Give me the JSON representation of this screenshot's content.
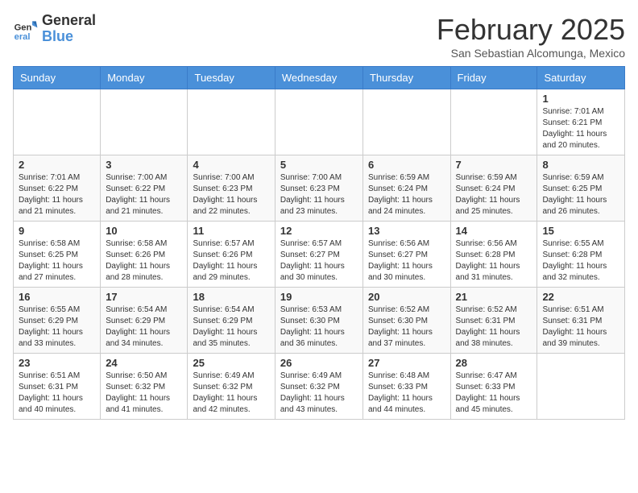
{
  "header": {
    "logo_general": "General",
    "logo_blue": "Blue",
    "month_title": "February 2025",
    "location": "San Sebastian Alcomunga, Mexico"
  },
  "weekdays": [
    "Sunday",
    "Monday",
    "Tuesday",
    "Wednesday",
    "Thursday",
    "Friday",
    "Saturday"
  ],
  "weeks": [
    [
      {
        "day": "",
        "info": ""
      },
      {
        "day": "",
        "info": ""
      },
      {
        "day": "",
        "info": ""
      },
      {
        "day": "",
        "info": ""
      },
      {
        "day": "",
        "info": ""
      },
      {
        "day": "",
        "info": ""
      },
      {
        "day": "1",
        "info": "Sunrise: 7:01 AM\nSunset: 6:21 PM\nDaylight: 11 hours and 20 minutes."
      }
    ],
    [
      {
        "day": "2",
        "info": "Sunrise: 7:01 AM\nSunset: 6:22 PM\nDaylight: 11 hours and 21 minutes."
      },
      {
        "day": "3",
        "info": "Sunrise: 7:00 AM\nSunset: 6:22 PM\nDaylight: 11 hours and 21 minutes."
      },
      {
        "day": "4",
        "info": "Sunrise: 7:00 AM\nSunset: 6:23 PM\nDaylight: 11 hours and 22 minutes."
      },
      {
        "day": "5",
        "info": "Sunrise: 7:00 AM\nSunset: 6:23 PM\nDaylight: 11 hours and 23 minutes."
      },
      {
        "day": "6",
        "info": "Sunrise: 6:59 AM\nSunset: 6:24 PM\nDaylight: 11 hours and 24 minutes."
      },
      {
        "day": "7",
        "info": "Sunrise: 6:59 AM\nSunset: 6:24 PM\nDaylight: 11 hours and 25 minutes."
      },
      {
        "day": "8",
        "info": "Sunrise: 6:59 AM\nSunset: 6:25 PM\nDaylight: 11 hours and 26 minutes."
      }
    ],
    [
      {
        "day": "9",
        "info": "Sunrise: 6:58 AM\nSunset: 6:25 PM\nDaylight: 11 hours and 27 minutes."
      },
      {
        "day": "10",
        "info": "Sunrise: 6:58 AM\nSunset: 6:26 PM\nDaylight: 11 hours and 28 minutes."
      },
      {
        "day": "11",
        "info": "Sunrise: 6:57 AM\nSunset: 6:26 PM\nDaylight: 11 hours and 29 minutes."
      },
      {
        "day": "12",
        "info": "Sunrise: 6:57 AM\nSunset: 6:27 PM\nDaylight: 11 hours and 30 minutes."
      },
      {
        "day": "13",
        "info": "Sunrise: 6:56 AM\nSunset: 6:27 PM\nDaylight: 11 hours and 30 minutes."
      },
      {
        "day": "14",
        "info": "Sunrise: 6:56 AM\nSunset: 6:28 PM\nDaylight: 11 hours and 31 minutes."
      },
      {
        "day": "15",
        "info": "Sunrise: 6:55 AM\nSunset: 6:28 PM\nDaylight: 11 hours and 32 minutes."
      }
    ],
    [
      {
        "day": "16",
        "info": "Sunrise: 6:55 AM\nSunset: 6:29 PM\nDaylight: 11 hours and 33 minutes."
      },
      {
        "day": "17",
        "info": "Sunrise: 6:54 AM\nSunset: 6:29 PM\nDaylight: 11 hours and 34 minutes."
      },
      {
        "day": "18",
        "info": "Sunrise: 6:54 AM\nSunset: 6:29 PM\nDaylight: 11 hours and 35 minutes."
      },
      {
        "day": "19",
        "info": "Sunrise: 6:53 AM\nSunset: 6:30 PM\nDaylight: 11 hours and 36 minutes."
      },
      {
        "day": "20",
        "info": "Sunrise: 6:52 AM\nSunset: 6:30 PM\nDaylight: 11 hours and 37 minutes."
      },
      {
        "day": "21",
        "info": "Sunrise: 6:52 AM\nSunset: 6:31 PM\nDaylight: 11 hours and 38 minutes."
      },
      {
        "day": "22",
        "info": "Sunrise: 6:51 AM\nSunset: 6:31 PM\nDaylight: 11 hours and 39 minutes."
      }
    ],
    [
      {
        "day": "23",
        "info": "Sunrise: 6:51 AM\nSunset: 6:31 PM\nDaylight: 11 hours and 40 minutes."
      },
      {
        "day": "24",
        "info": "Sunrise: 6:50 AM\nSunset: 6:32 PM\nDaylight: 11 hours and 41 minutes."
      },
      {
        "day": "25",
        "info": "Sunrise: 6:49 AM\nSunset: 6:32 PM\nDaylight: 11 hours and 42 minutes."
      },
      {
        "day": "26",
        "info": "Sunrise: 6:49 AM\nSunset: 6:32 PM\nDaylight: 11 hours and 43 minutes."
      },
      {
        "day": "27",
        "info": "Sunrise: 6:48 AM\nSunset: 6:33 PM\nDaylight: 11 hours and 44 minutes."
      },
      {
        "day": "28",
        "info": "Sunrise: 6:47 AM\nSunset: 6:33 PM\nDaylight: 11 hours and 45 minutes."
      },
      {
        "day": "",
        "info": ""
      }
    ]
  ]
}
